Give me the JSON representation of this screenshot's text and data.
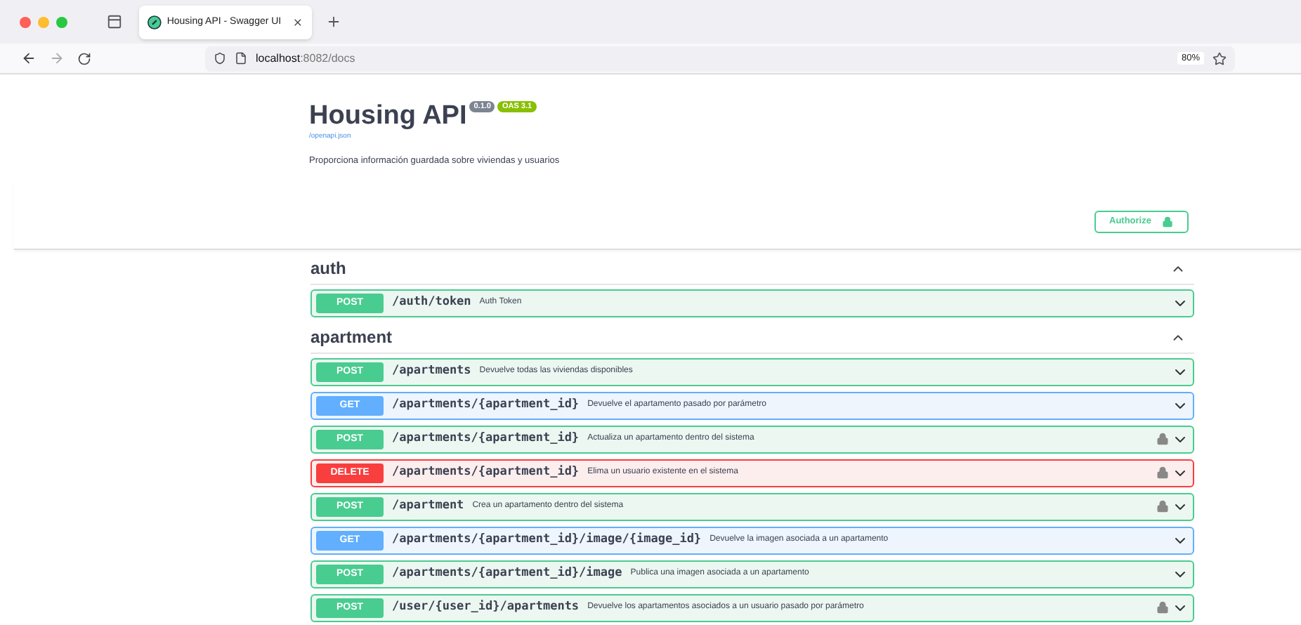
{
  "browser": {
    "tab": {
      "title": "Housing API - Swagger UI",
      "selected": true
    },
    "url_host": "localhost",
    "url_rest": ":8082/docs",
    "zoom": "80%"
  },
  "info": {
    "title": "Housing API",
    "version": "0.1.0",
    "oas": "OAS 3.1",
    "link": "/openapi.json",
    "description": "Proporciona información guardada sobre viviendas y usuarios"
  },
  "authorize": {
    "label": "Authorize"
  },
  "sections": [
    {
      "name": "auth",
      "expanded": true,
      "operations": [
        {
          "method": "POST",
          "path": "/auth/token",
          "summary": "Auth Token",
          "locked": false
        }
      ]
    },
    {
      "name": "apartment",
      "expanded": true,
      "operations": [
        {
          "method": "POST",
          "path": "/apartments",
          "summary": "Devuelve todas las viviendas disponibles",
          "locked": false
        },
        {
          "method": "GET",
          "path": "/apartments/{apartment_id}",
          "summary": "Devuelve el apartamento pasado por parámetro",
          "locked": false
        },
        {
          "method": "POST",
          "path": "/apartments/{apartment_id}",
          "summary": "Actualiza un apartamento dentro del sistema",
          "locked": true
        },
        {
          "method": "DELETE",
          "path": "/apartments/{apartment_id}",
          "summary": "Elima un usuario existente en el sistema",
          "locked": true
        },
        {
          "method": "POST",
          "path": "/apartment",
          "summary": "Crea un apartamento dentro del sistema",
          "locked": true
        },
        {
          "method": "GET",
          "path": "/apartments/{apartment_id}/image/{image_id}",
          "summary": "Devuelve la imagen asociada a un apartamento",
          "locked": false
        },
        {
          "method": "POST",
          "path": "/apartments/{apartment_id}/image",
          "summary": "Publica una imagen asociada a un apartamento",
          "locked": false
        },
        {
          "method": "POST",
          "path": "/user/{user_id}/apartments",
          "summary": "Devuelve los apartamentos asociados a un usuario pasado por parámetro",
          "locked": true
        }
      ]
    }
  ]
}
